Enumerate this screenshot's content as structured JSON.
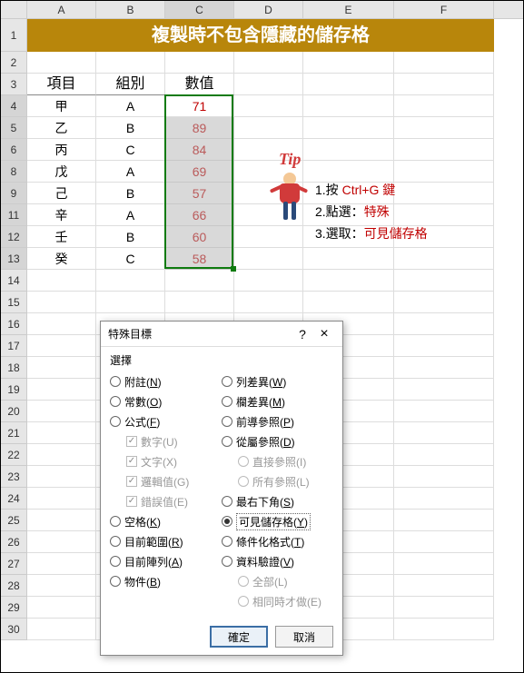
{
  "columns": [
    "A",
    "B",
    "C",
    "D",
    "E",
    "F"
  ],
  "rows": [
    "1",
    "2",
    "3",
    "4",
    "5",
    "6",
    "8",
    "9",
    "11",
    "12",
    "13",
    "14",
    "15",
    "16",
    "17",
    "18",
    "19",
    "20",
    "21",
    "22",
    "23",
    "24",
    "25",
    "26",
    "27",
    "28",
    "29",
    "30"
  ],
  "selected_col": "C",
  "selected_rows": [
    "4",
    "5",
    "6",
    "8",
    "9",
    "11",
    "12",
    "13"
  ],
  "title": "複製時不包含隱藏的儲存格",
  "table": {
    "headers": {
      "item": "項目",
      "group": "組別",
      "value": "數值"
    },
    "rows": [
      {
        "item": "甲",
        "group": "A",
        "value": "71"
      },
      {
        "item": "乙",
        "group": "B",
        "value": "89"
      },
      {
        "item": "丙",
        "group": "C",
        "value": "84"
      },
      {
        "item": "戊",
        "group": "A",
        "value": "69"
      },
      {
        "item": "己",
        "group": "B",
        "value": "57"
      },
      {
        "item": "辛",
        "group": "A",
        "value": "66"
      },
      {
        "item": "壬",
        "group": "B",
        "value": "60"
      },
      {
        "item": "癸",
        "group": "C",
        "value": "58"
      }
    ]
  },
  "tip": {
    "label": "Tip",
    "lines": [
      {
        "prefix": "1.按 ",
        "key": "Ctrl+G 鍵"
      },
      {
        "prefix": "2.點選：",
        "key": "特殊"
      },
      {
        "prefix": "3.選取：",
        "key": "可見儲存格"
      }
    ]
  },
  "dialog": {
    "title": "特殊目標",
    "section": "選擇",
    "left": [
      {
        "type": "radio",
        "label": "附註(",
        "u": "N",
        "suffix": ")"
      },
      {
        "type": "radio",
        "label": "常數(",
        "u": "O",
        "suffix": ")"
      },
      {
        "type": "radio",
        "label": "公式(",
        "u": "F",
        "suffix": ")",
        "checked": false
      },
      {
        "type": "checkbox",
        "label": "數字(U)",
        "sub": true,
        "checked": true,
        "disabled": true
      },
      {
        "type": "checkbox",
        "label": "文字(X)",
        "sub": true,
        "checked": true,
        "disabled": true
      },
      {
        "type": "checkbox",
        "label": "邏輯值(G)",
        "sub": true,
        "checked": true,
        "disabled": true
      },
      {
        "type": "checkbox",
        "label": "錯誤值(E)",
        "sub": true,
        "checked": true,
        "disabled": true
      },
      {
        "type": "radio",
        "label": "空格(",
        "u": "K",
        "suffix": ")"
      },
      {
        "type": "radio",
        "label": "目前範圍(",
        "u": "R",
        "suffix": ")"
      },
      {
        "type": "radio",
        "label": "目前陣列(",
        "u": "A",
        "suffix": ")"
      },
      {
        "type": "radio",
        "label": "物件(",
        "u": "B",
        "suffix": ")"
      }
    ],
    "right": [
      {
        "type": "radio",
        "label": "列差異(",
        "u": "W",
        "suffix": ")"
      },
      {
        "type": "radio",
        "label": "欄差異(",
        "u": "M",
        "suffix": ")"
      },
      {
        "type": "radio",
        "label": "前導參照(",
        "u": "P",
        "suffix": ")"
      },
      {
        "type": "radio",
        "label": "從屬參照(",
        "u": "D",
        "suffix": ")"
      },
      {
        "type": "radio",
        "label": "直接參照(I)",
        "sub": true,
        "disabled": true
      },
      {
        "type": "radio",
        "label": "所有參照(L)",
        "sub": true,
        "disabled": true
      },
      {
        "type": "radio",
        "label": "最右下角(",
        "u": "S",
        "suffix": ")"
      },
      {
        "type": "radio",
        "label": "可見儲存格(",
        "u": "Y",
        "suffix": ")",
        "checked": true,
        "highlight": true
      },
      {
        "type": "radio",
        "label": "條件化格式(",
        "u": "T",
        "suffix": ")"
      },
      {
        "type": "radio",
        "label": "資料驗證(",
        "u": "V",
        "suffix": ")"
      },
      {
        "type": "radio",
        "label": "全部(L)",
        "sub": true,
        "disabled": true
      },
      {
        "type": "radio",
        "label": "相同時才做(E)",
        "sub": true,
        "disabled": true
      }
    ],
    "ok": "確定",
    "cancel": "取消"
  }
}
